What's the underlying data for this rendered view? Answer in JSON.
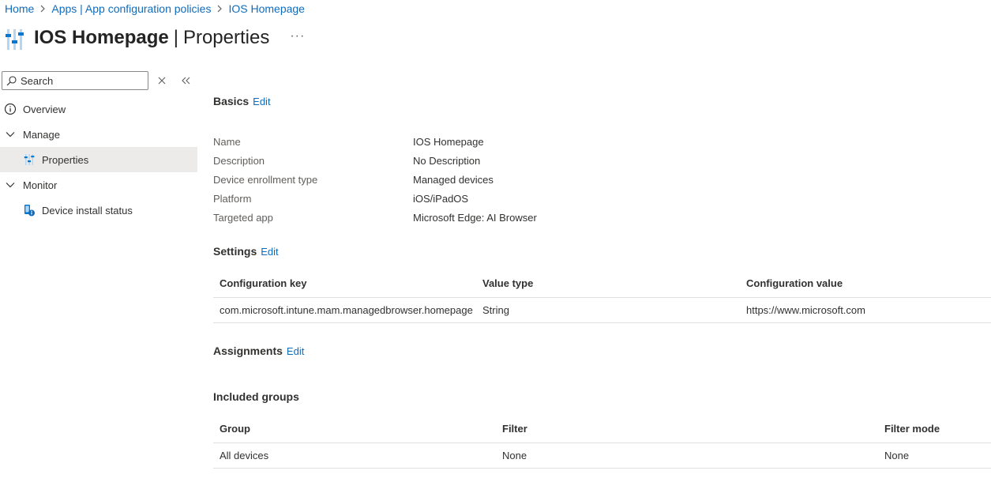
{
  "breadcrumb": {
    "items": [
      "Home",
      "Apps | App configuration policies",
      "IOS Homepage"
    ]
  },
  "header": {
    "title_main": "IOS Homepage",
    "title_sep": "|",
    "title_sub": "Properties",
    "more_label": "···",
    "icon": "sliders-icon"
  },
  "sidebar": {
    "search_placeholder": "Search",
    "items": [
      {
        "label": "Overview",
        "icon": "info-icon"
      },
      {
        "label": "Manage",
        "icon": "chevron-down-icon"
      },
      {
        "label": "Properties",
        "icon": "sliders-icon",
        "selected": true
      },
      {
        "label": "Monitor",
        "icon": "chevron-down-icon"
      },
      {
        "label": "Device install status",
        "icon": "device-status-icon"
      }
    ]
  },
  "basics": {
    "heading": "Basics",
    "edit_label": "Edit",
    "rows": [
      {
        "key": "Name",
        "value": "IOS Homepage"
      },
      {
        "key": "Description",
        "value": "No Description"
      },
      {
        "key": "Device enrollment type",
        "value": "Managed devices"
      },
      {
        "key": "Platform",
        "value": "iOS/iPadOS"
      },
      {
        "key": "Targeted app",
        "value": "Microsoft Edge: AI Browser"
      }
    ]
  },
  "settings": {
    "heading": "Settings",
    "edit_label": "Edit",
    "columns": [
      "Configuration key",
      "Value type",
      "Configuration value"
    ],
    "rows": [
      [
        "com.microsoft.intune.mam.managedbrowser.homepage",
        "String",
        "https://www.microsoft.com"
      ]
    ]
  },
  "assignments": {
    "heading": "Assignments",
    "edit_label": "Edit",
    "included_heading": "Included groups",
    "columns": [
      "Group",
      "Filter",
      "Filter mode"
    ],
    "rows": [
      [
        "All devices",
        "None",
        "None"
      ]
    ]
  },
  "colors": {
    "link": "#0f6cbd",
    "selected_bg": "#edebe9",
    "border": "#e1dfdd"
  }
}
